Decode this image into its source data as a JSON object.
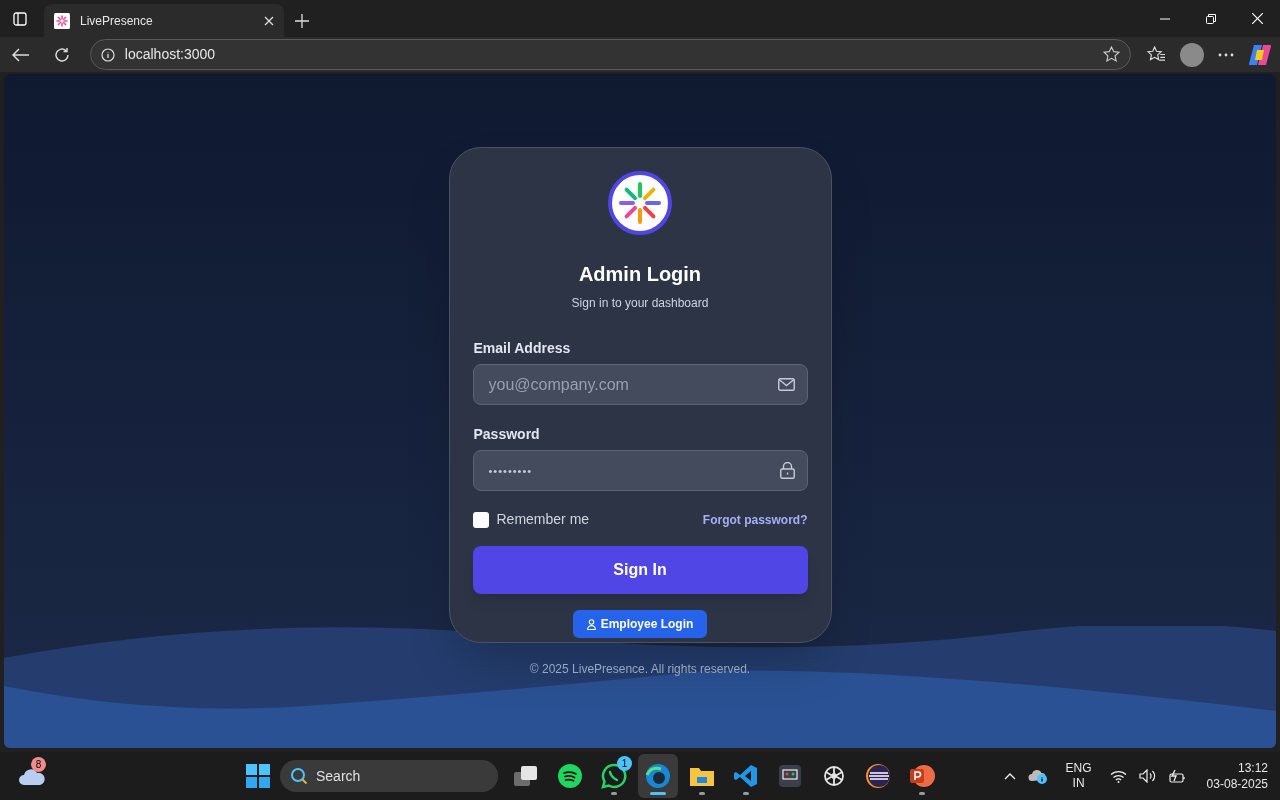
{
  "browser": {
    "tab_title": "LivePresence",
    "url": "localhost:3000"
  },
  "login": {
    "title": "Admin Login",
    "subtitle": "Sign in to your dashboard",
    "email": {
      "label": "Email Address",
      "placeholder": "you@company.com"
    },
    "password": {
      "label": "Password",
      "value": "•••••••••"
    },
    "remember_me": {
      "label": "Remember me",
      "checked": false
    },
    "forgot_link": "Forgot password?",
    "submit": "Sign In",
    "employee_login": "Employee Login"
  },
  "footer": "© 2025 LivePresence. All rights reserved.",
  "taskbar": {
    "weather_badge": "8",
    "search_placeholder": "Search",
    "apps": [
      {
        "kind": "task-view",
        "selected": false,
        "running": false
      },
      {
        "kind": "spotify",
        "selected": false,
        "running": false
      },
      {
        "kind": "whatsapp",
        "selected": false,
        "running": true,
        "badge": "1"
      },
      {
        "kind": "edge",
        "selected": true,
        "running": true
      },
      {
        "kind": "files",
        "selected": false,
        "running": true
      },
      {
        "kind": "vscode",
        "selected": false,
        "running": true
      },
      {
        "kind": "remote",
        "selected": false,
        "running": false
      },
      {
        "kind": "chatgpt",
        "selected": false,
        "running": false
      },
      {
        "kind": "eclipse",
        "selected": false,
        "running": false
      },
      {
        "kind": "powerpoint",
        "selected": false,
        "running": true
      }
    ],
    "language": [
      "ENG",
      "IN"
    ],
    "time": "13:12",
    "date": "03-08-2025"
  }
}
